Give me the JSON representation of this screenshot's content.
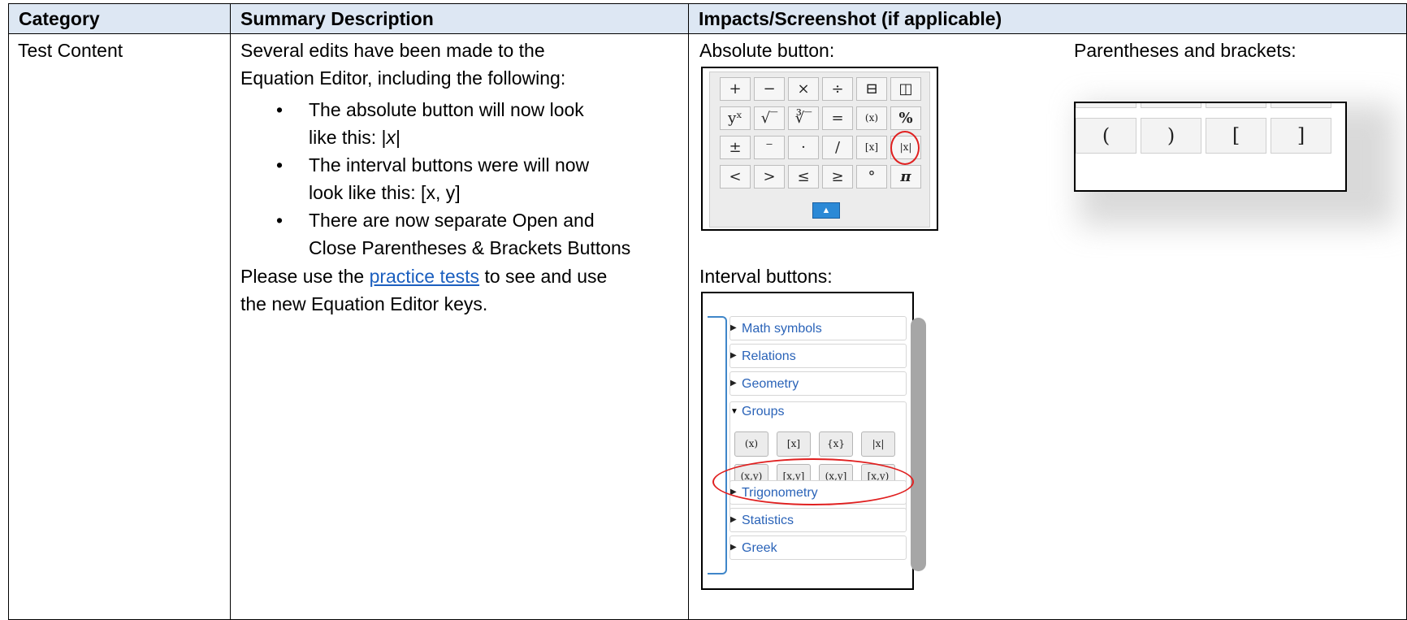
{
  "table": {
    "headers": [
      "Category",
      "Summary Description",
      "Impacts/Screenshot (if applicable)"
    ],
    "category": "Test Content",
    "summary": {
      "intro_line1": "Several edits have been made to the",
      "intro_line2": "Equation Editor, including the following:",
      "bullets": [
        {
          "line1": "The absolute button will now look",
          "line2_prefix": "like this: |",
          "line2_var": "x",
          "line2_suffix": "|"
        },
        {
          "line1": "The interval buttons were will now",
          "line2": "look like this: [x, y]"
        },
        {
          "line1": "There are now separate Open and",
          "line2": "Close Parentheses & Brackets Buttons"
        }
      ],
      "outro_prefix": "Please use the ",
      "outro_link": "practice tests",
      "outro_suffix": " to see and use",
      "outro_line2": "the new Equation Editor keys."
    }
  },
  "impacts": {
    "absolute_label": "Absolute button:",
    "parentheses_label": "Parentheses and brackets:",
    "interval_label": "Interval buttons:"
  },
  "keypad": {
    "keys": [
      "+",
      "−",
      "×",
      "÷",
      "⊟",
      "◫",
      "yˣ",
      "√‾",
      "∛‾",
      "=",
      "(x)",
      "%",
      "±",
      "⁻",
      "·",
      "/",
      "[x]",
      "|x|",
      "<",
      ">",
      "≤",
      "≥",
      "°",
      "π"
    ],
    "toggle_icon": "caret-up-icon"
  },
  "paren_keys": [
    "(",
    ")",
    "[",
    "]"
  ],
  "interval_panel": {
    "sections_top": [
      "Math symbols",
      "Relations",
      "Geometry"
    ],
    "groups_label": "Groups",
    "group_row1": [
      "(x)",
      "[x]",
      "{x}",
      "|x|"
    ],
    "group_row2": [
      "(x,y)",
      "[x,y]",
      "(x,y]",
      "[x,y)"
    ],
    "sections_bottom": [
      "Trigonometry",
      "Statistics",
      "Greek"
    ]
  },
  "colors": {
    "header_bg": "#dde7f3",
    "link": "#1b5fbf",
    "highlight_circle": "#e02020",
    "accordion_text": "#2a63b8"
  }
}
